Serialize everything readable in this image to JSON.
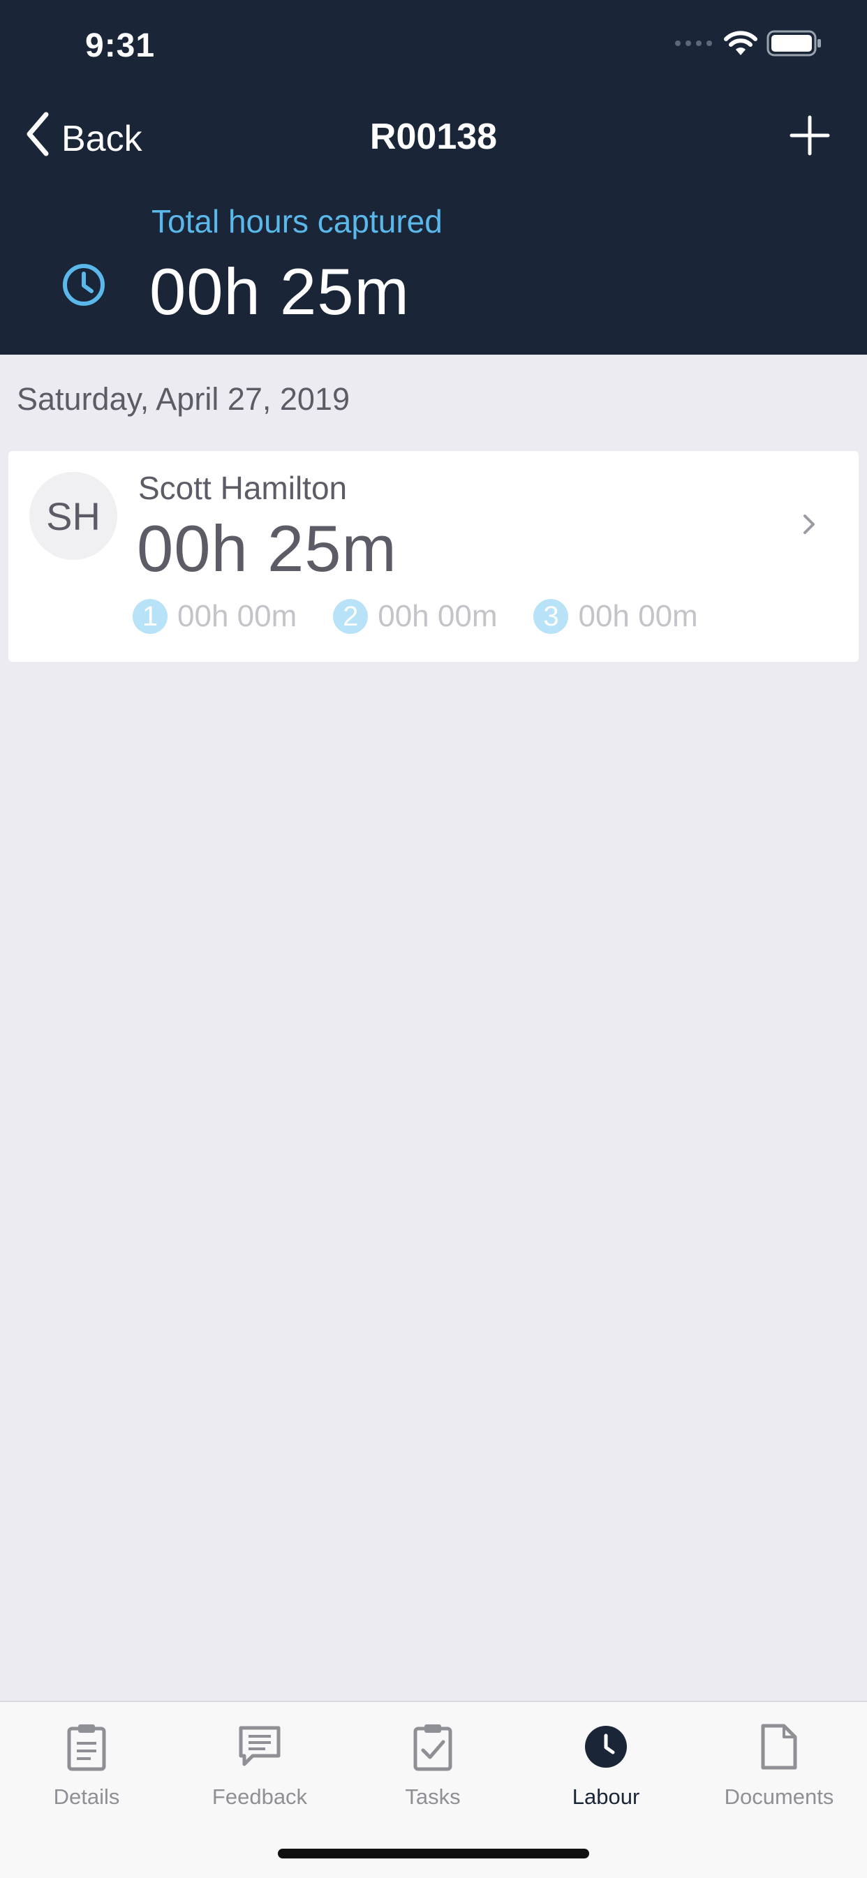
{
  "status_bar": {
    "time": "9:31"
  },
  "nav": {
    "back_label": "Back",
    "title": "R00138"
  },
  "summary": {
    "label": "Total hours captured",
    "value": "00h 25m"
  },
  "date_header": "Saturday, April 27, 2019",
  "entries": [
    {
      "initials": "SH",
      "name": "Scott Hamilton",
      "hours": "00h 25m",
      "breakdown": [
        {
          "num": "1",
          "value": "00h 00m"
        },
        {
          "num": "2",
          "value": "00h 00m"
        },
        {
          "num": "3",
          "value": "00h 00m"
        }
      ]
    }
  ],
  "tabs": [
    {
      "label": "Details",
      "icon": "clipboard-icon"
    },
    {
      "label": "Feedback",
      "icon": "feedback-icon"
    },
    {
      "label": "Tasks",
      "icon": "clipboard-check-icon"
    },
    {
      "label": "Labour",
      "icon": "clock-icon",
      "active": true
    },
    {
      "label": "Documents",
      "icon": "document-icon"
    }
  ],
  "colors": {
    "header_bg": "#1a2638",
    "accent": "#5ab8ea",
    "background": "#ebebf1"
  }
}
